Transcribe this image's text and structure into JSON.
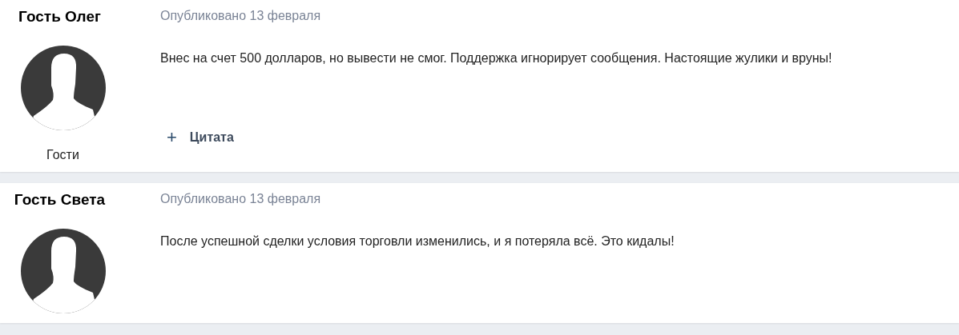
{
  "posts": [
    {
      "author": "Гость Олег",
      "group": "Гости",
      "date": "Опубликовано 13 февраля",
      "body": "Внес на счет 500 долларов, но вывести не смог. Поддержка игнорирует сообщения. Настоящие жулики и вруны!",
      "quote_label": "Цитата",
      "quote_icon": "+"
    },
    {
      "author": "Гость Света",
      "date": "Опубликовано 13 февраля",
      "body": "После успешной сделки условия торговли изменились, и я потеряла всё. Это кидалы!"
    }
  ]
}
